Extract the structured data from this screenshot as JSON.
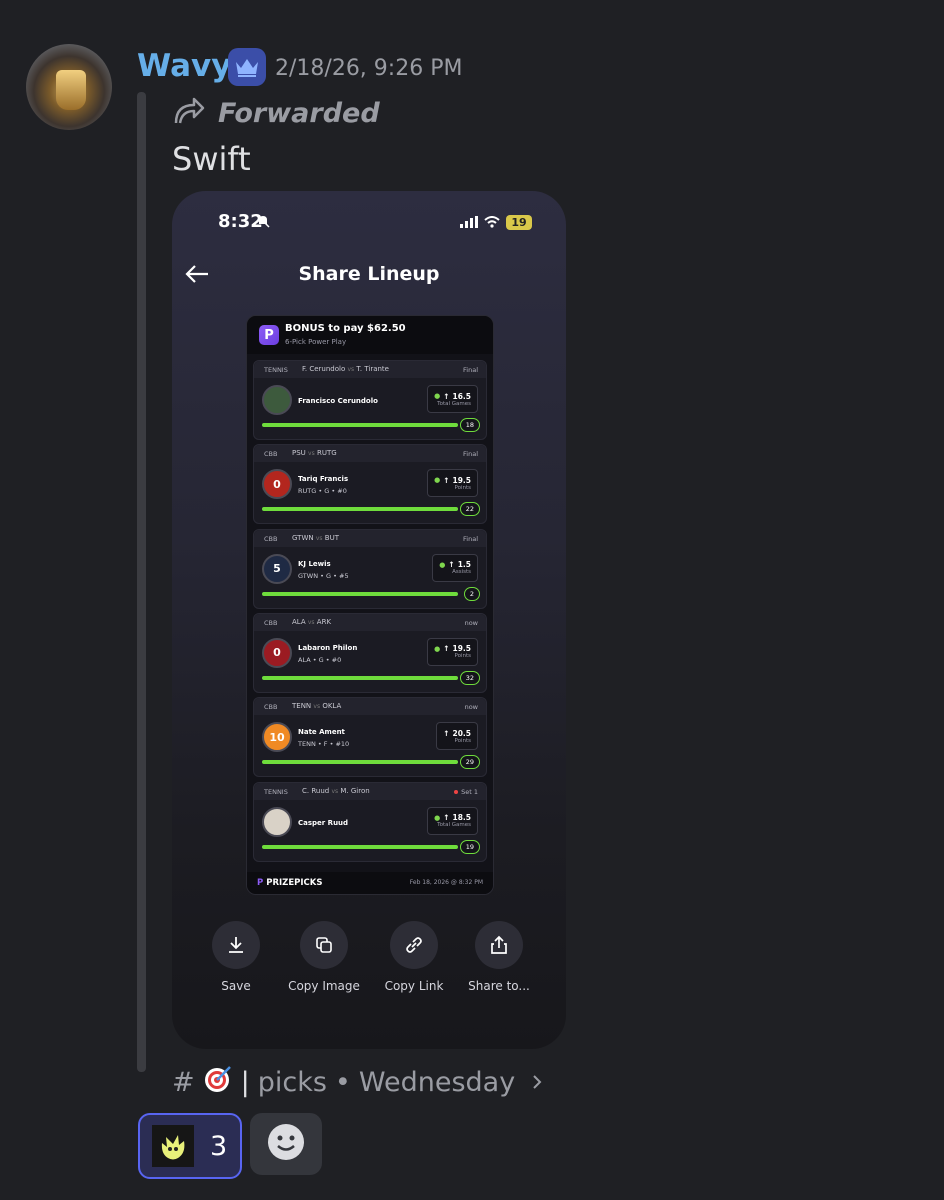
{
  "message": {
    "username": "Wavy",
    "timestamp": "2/18/26, 9:26 PM",
    "forwarded_label": "Forwarded",
    "text": "Swift",
    "username_color": "#66aee8"
  },
  "phone": {
    "status_time": "8:32",
    "battery": "19",
    "screen_title": "Share Lineup",
    "card": {
      "bonus": "BONUS to pay $62.50",
      "play_type": "6-Pick Power Play",
      "footer_brand": "PRIZEPICKS",
      "footer_date": "Feb 18, 2026 @ 8:32 PM",
      "picks": [
        {
          "sport": "TENNIS",
          "home": "F. Cerundolo",
          "away": "T. Tirante",
          "status": "Final",
          "player": "Francisco Cerundolo",
          "sub": "",
          "avatar": "",
          "line": "16.5",
          "stat": "Total Games",
          "value": "18",
          "goblin": true,
          "live": false,
          "avatar_color": "#3d5a3d"
        },
        {
          "sport": "CBB",
          "home": "PSU",
          "away": "RUTG",
          "status": "Final",
          "player": "Tariq Francis",
          "sub": "RUTG • G • #0",
          "avatar": "0",
          "line": "19.5",
          "stat": "Points",
          "value": "22",
          "goblin": true,
          "live": false,
          "avatar_color": "#b3261e"
        },
        {
          "sport": "CBB",
          "home": "GTWN",
          "away": "BUT",
          "status": "Final",
          "player": "KJ Lewis",
          "sub": "GTWN • G • #5",
          "avatar": "5",
          "line": "1.5",
          "stat": "Assists",
          "value": "2",
          "goblin": true,
          "live": false,
          "avatar_color": "#1f2a44"
        },
        {
          "sport": "CBB",
          "home": "ALA",
          "away": "ARK",
          "status": "now",
          "player": "Labaron Philon",
          "sub": "ALA • G • #0",
          "avatar": "0",
          "line": "19.5",
          "stat": "Points",
          "value": "32",
          "goblin": true,
          "live": false,
          "avatar_color": "#9b1b22"
        },
        {
          "sport": "CBB",
          "home": "TENN",
          "away": "OKLA",
          "status": "now",
          "player": "Nate Ament",
          "sub": "TENN • F • #10",
          "avatar": "10",
          "line": "20.5",
          "stat": "Points",
          "value": "29",
          "goblin": false,
          "live": false,
          "avatar_color": "#f08a24"
        },
        {
          "sport": "TENNIS",
          "home": "C. Ruud",
          "away": "M. Giron",
          "status": "Set 1",
          "player": "Casper Ruud",
          "sub": "",
          "avatar": "",
          "line": "18.5",
          "stat": "Total Games",
          "value": "19",
          "goblin": true,
          "live": true,
          "avatar_color": "#d9d2c7"
        }
      ]
    },
    "actions": [
      {
        "label": "Save",
        "icon": "download-icon"
      },
      {
        "label": "Copy Image",
        "icon": "copy-icon"
      },
      {
        "label": "Copy Link",
        "icon": "link-icon"
      },
      {
        "label": "Share to...",
        "icon": "share-icon"
      }
    ]
  },
  "channel": {
    "hash": "#",
    "separator": "|",
    "name": "picks",
    "bullet": "•",
    "day": "Wednesday"
  },
  "reactions": {
    "count": "3"
  }
}
